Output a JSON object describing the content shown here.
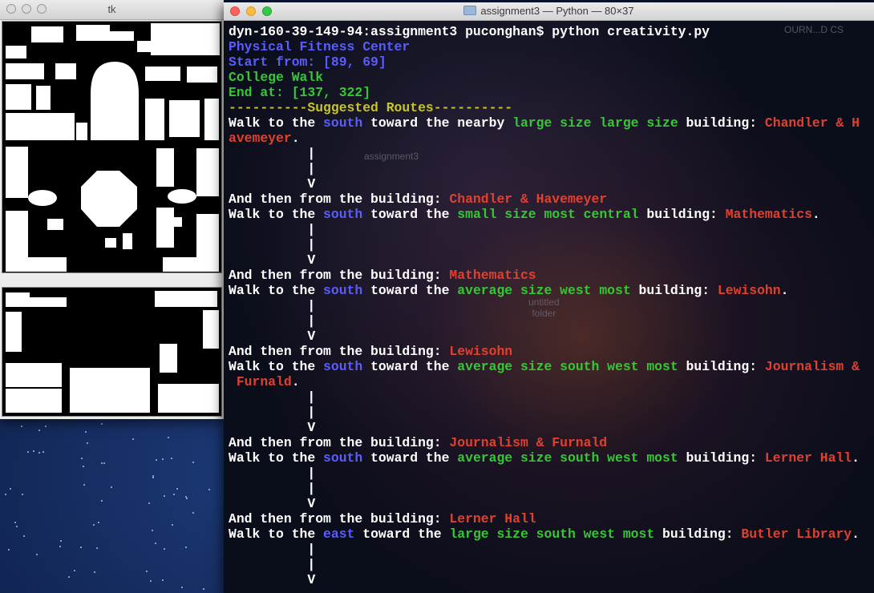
{
  "tk_window": {
    "title": "tk"
  },
  "terminal_window": {
    "title": "assignment3 — Python — 80×37",
    "desktop_labels": {
      "top_right": "OURN...D CS",
      "assignment3": "assignment3",
      "untitled_folder": "untitled\nfolder"
    },
    "lines": [
      {
        "segs": [
          [
            "dyn-160-39-149-94:assignment3 puconghan$ python creativity.py",
            "white"
          ]
        ]
      },
      {
        "segs": [
          [
            "Physical Fitness Center",
            "blue"
          ]
        ]
      },
      {
        "segs": [
          [
            "Start from: [89, 69]",
            "blue"
          ]
        ]
      },
      {
        "segs": [
          [
            "College Walk",
            "green"
          ]
        ]
      },
      {
        "segs": [
          [
            "End at: [137, 322]",
            "green"
          ]
        ]
      },
      {
        "segs": [
          [
            "----------Suggested Routes----------",
            "yellow"
          ]
        ]
      },
      {
        "segs": [
          [
            "Walk to the ",
            "white"
          ],
          [
            "south",
            "blue"
          ],
          [
            " toward the nearby ",
            "white"
          ],
          [
            "large size large size",
            "green"
          ],
          [
            " building: ",
            "white"
          ],
          [
            "Chandler & H",
            "red"
          ]
        ]
      },
      {
        "segs": [
          [
            "avemeyer",
            "red"
          ],
          [
            ".",
            "white"
          ]
        ]
      },
      {
        "segs": [
          [
            "          |",
            "white"
          ]
        ]
      },
      {
        "segs": [
          [
            "          |",
            "white"
          ]
        ]
      },
      {
        "segs": [
          [
            "          V",
            "white"
          ]
        ]
      },
      {
        "segs": [
          [
            "And then from the building: ",
            "white"
          ],
          [
            "Chandler & Havemeyer",
            "red"
          ]
        ]
      },
      {
        "segs": [
          [
            "Walk to the ",
            "white"
          ],
          [
            "south",
            "blue"
          ],
          [
            " toward the ",
            "white"
          ],
          [
            "small size most central",
            "green"
          ],
          [
            " building: ",
            "white"
          ],
          [
            "Mathematics",
            "red"
          ],
          [
            ".",
            "white"
          ]
        ]
      },
      {
        "segs": [
          [
            "          |",
            "white"
          ]
        ]
      },
      {
        "segs": [
          [
            "          |",
            "white"
          ]
        ]
      },
      {
        "segs": [
          [
            "          V",
            "white"
          ]
        ]
      },
      {
        "segs": [
          [
            "And then from the building: ",
            "white"
          ],
          [
            "Mathematics",
            "red"
          ]
        ]
      },
      {
        "segs": [
          [
            "Walk to the ",
            "white"
          ],
          [
            "south",
            "blue"
          ],
          [
            " toward the ",
            "white"
          ],
          [
            "average size west most",
            "green"
          ],
          [
            " building: ",
            "white"
          ],
          [
            "Lewisohn",
            "red"
          ],
          [
            ".",
            "white"
          ]
        ]
      },
      {
        "segs": [
          [
            "          |",
            "white"
          ]
        ]
      },
      {
        "segs": [
          [
            "          |",
            "white"
          ]
        ]
      },
      {
        "segs": [
          [
            "          V",
            "white"
          ]
        ]
      },
      {
        "segs": [
          [
            "And then from the building: ",
            "white"
          ],
          [
            "Lewisohn",
            "red"
          ]
        ]
      },
      {
        "segs": [
          [
            "Walk to the ",
            "white"
          ],
          [
            "south",
            "blue"
          ],
          [
            " toward the ",
            "white"
          ],
          [
            "average size south west most",
            "green"
          ],
          [
            " building: ",
            "white"
          ],
          [
            "Journalism &",
            "red"
          ]
        ]
      },
      {
        "segs": [
          [
            " Furnald",
            "red"
          ],
          [
            ".",
            "white"
          ]
        ]
      },
      {
        "segs": [
          [
            "          |",
            "white"
          ]
        ]
      },
      {
        "segs": [
          [
            "          |",
            "white"
          ]
        ]
      },
      {
        "segs": [
          [
            "          V",
            "white"
          ]
        ]
      },
      {
        "segs": [
          [
            "And then from the building: ",
            "white"
          ],
          [
            "Journalism & Furnald",
            "red"
          ]
        ]
      },
      {
        "segs": [
          [
            "Walk to the ",
            "white"
          ],
          [
            "south",
            "blue"
          ],
          [
            " toward the ",
            "white"
          ],
          [
            "average size south west most",
            "green"
          ],
          [
            " building: ",
            "white"
          ],
          [
            "Lerner Hall",
            "red"
          ],
          [
            ".",
            "white"
          ]
        ]
      },
      {
        "segs": [
          [
            "          |",
            "white"
          ]
        ]
      },
      {
        "segs": [
          [
            "          |",
            "white"
          ]
        ]
      },
      {
        "segs": [
          [
            "          V",
            "white"
          ]
        ]
      },
      {
        "segs": [
          [
            "And then from the building: ",
            "white"
          ],
          [
            "Lerner Hall",
            "red"
          ]
        ]
      },
      {
        "segs": [
          [
            "Walk to the ",
            "white"
          ],
          [
            "east",
            "blue"
          ],
          [
            " toward the ",
            "white"
          ],
          [
            "large size south west most",
            "green"
          ],
          [
            " building: ",
            "white"
          ],
          [
            "Butler Library",
            "red"
          ],
          [
            ".",
            "white"
          ]
        ]
      },
      {
        "segs": [
          [
            "          |",
            "white"
          ]
        ]
      },
      {
        "segs": [
          [
            "          |",
            "white"
          ]
        ]
      },
      {
        "segs": [
          [
            "          V",
            "white"
          ]
        ]
      }
    ]
  },
  "colors": {
    "white": "#ffffff",
    "blue": "#5a5cff",
    "green": "#35c834",
    "red": "#e0412f",
    "yellow": "#c7c42a"
  }
}
